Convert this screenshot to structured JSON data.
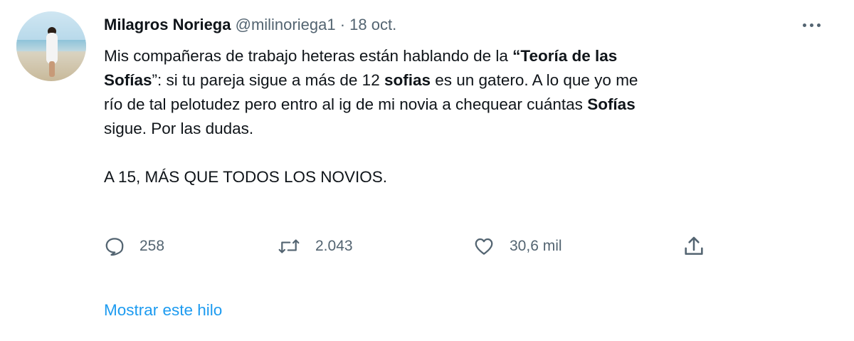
{
  "tweet": {
    "author_name": "Milagros Noriega",
    "author_handle": "@milinoriega1",
    "separator": "·",
    "date": "18 oct.",
    "text": {
      "l1a": "Mis compañeras de trabajo heteras están hablando de la ",
      "l1b": "“Teoría de las",
      "l2a": "Sofías",
      "l2b": "”: si tu pareja sigue a más de 12 ",
      "l2c": "sofias",
      "l2d": " es un gatero. A lo que yo me",
      "l3a": "río de tal pelotudez pero entro al ig de mi novia a chequear cuántas ",
      "l3b": "Sofías",
      "l4": "sigue. Por las dudas.",
      "l5": "A 15, MÁS QUE TODOS LOS NOVIOS."
    },
    "actions": {
      "replies": "258",
      "retweets": "2.043",
      "likes": "30,6 mil"
    },
    "show_thread": "Mostrar este hilo"
  },
  "icons": {
    "avatar": "profile-photo",
    "more": "more-dots-icon",
    "reply": "reply-icon",
    "retweet": "retweet-icon",
    "like": "heart-icon",
    "share": "share-icon"
  },
  "colors": {
    "text": "#0f1419",
    "secondary": "#536471",
    "link": "#1d9bf0",
    "background": "#ffffff"
  }
}
